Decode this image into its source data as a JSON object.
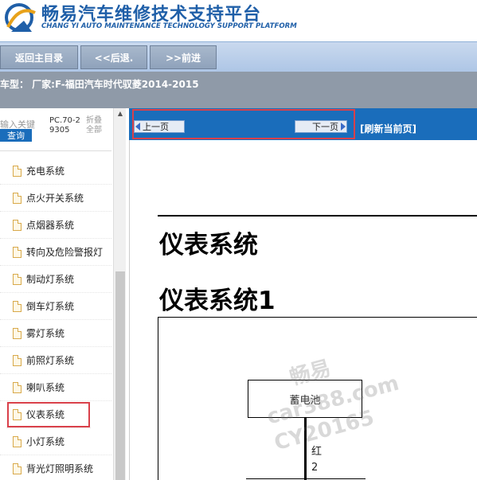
{
  "header": {
    "title_cn": "畅易汽车维修技术支持平台",
    "title_en": "CHANG YI AUTO MAINTENANCE TECHNOLOGY SUPPORT PLATFORM",
    "brand_color": "#1f5fa8"
  },
  "nav": {
    "home": "返回主目录",
    "back": "<<后退.",
    "forward": ">>前进"
  },
  "vehicle": {
    "info": "车型： 厂家:F-福田汽车时代驭菱2014-2015"
  },
  "search": {
    "placeholder": "输入关键",
    "button": "查询",
    "pc_label": "PC.70-29305",
    "fold_label": "折叠全部"
  },
  "systems": [
    {
      "label": "充电系统"
    },
    {
      "label": "点火开关系统"
    },
    {
      "label": "点烟器系统"
    },
    {
      "label": "转向及危险警报灯"
    },
    {
      "label": "制动灯系统"
    },
    {
      "label": "倒车灯系统"
    },
    {
      "label": "雾灯系统"
    },
    {
      "label": "前照灯系统"
    },
    {
      "label": "喇叭系统"
    },
    {
      "label": "仪表系统",
      "active": true
    },
    {
      "label": "小灯系统"
    },
    {
      "label": "背光灯照明系统"
    }
  ],
  "toolbar": {
    "prev": "上一页",
    "next": "下一页",
    "refresh": "[刷新当前页]",
    "accent": "#1a6dbb",
    "highlight": "#d9404a"
  },
  "content": {
    "title": "仪表系统",
    "subtitle": "仪表系统1",
    "component": "蓄电池",
    "wire_color": "红",
    "wire_number": "2"
  },
  "watermark": {
    "line1": "畅易",
    "line2": "car388.com",
    "line3": "CY20165"
  }
}
